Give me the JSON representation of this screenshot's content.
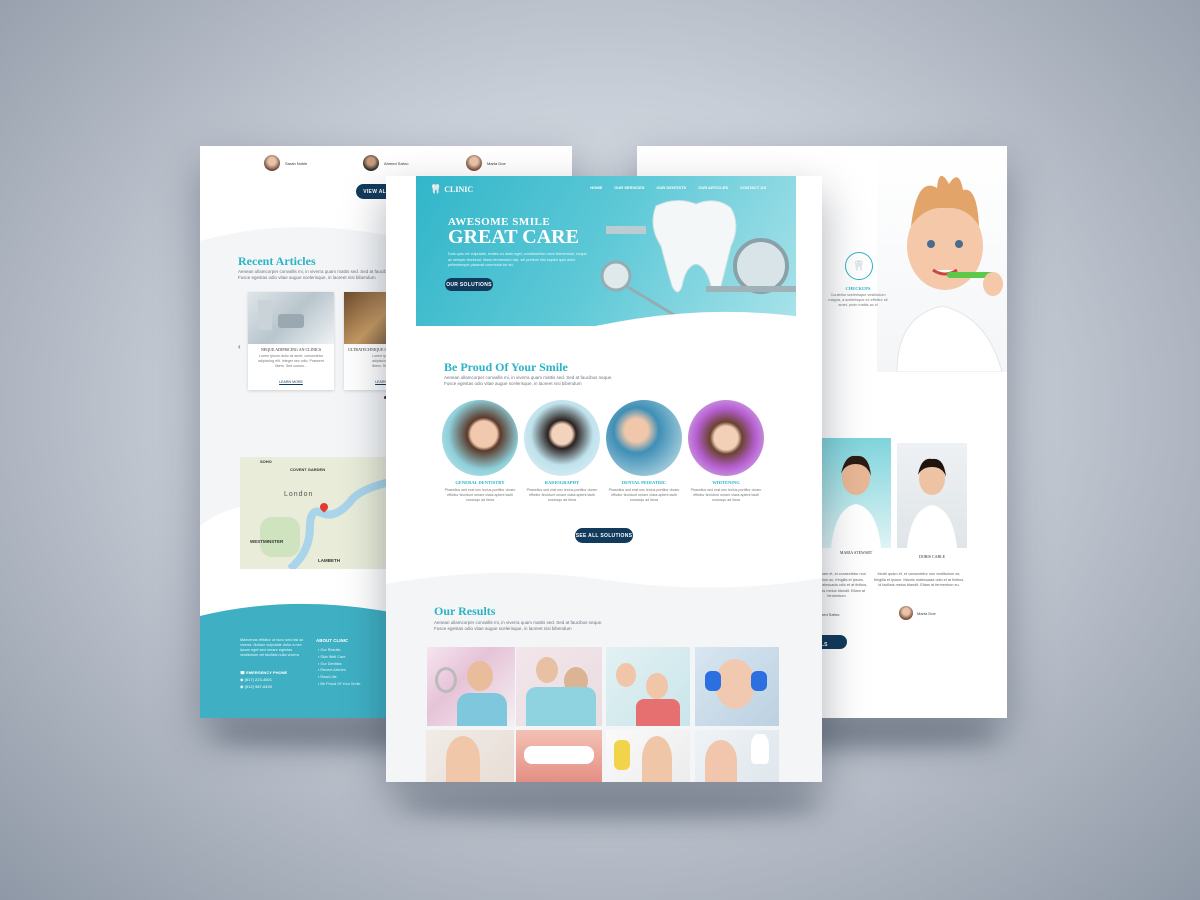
{
  "left": {
    "testimonials": [
      {
        "name": "Sarah Noble"
      },
      {
        "name": "Ahmed Sahro"
      },
      {
        "name": "Marta Doe"
      }
    ],
    "view_all_btn": "VIEW ALL TESTIMONIALS",
    "articles_title": "Recent Articles",
    "articles_text1": "Aenean ullamcorper convallis mi, in viverra quam mattis sed. Sed at faucibus neque.",
    "articles_text2": "Fusce egestas odio vitae augue scelerisque, in laoreet nisi bibendum",
    "article1_title": "NEQUE ADIPISCING AN CLINICS",
    "article1_text": "Lorem ipsum dolor sit amet, consectetur adipiscing elit. Integer nec odio. Praesent libero. Sed cursus...",
    "article1_link": "LEARN MORE",
    "article2_title": "ULTRATECHNIQUE IN DENTISTRY",
    "article2_text": "Lorem ipsum dolor sit amet, cor adipiscing elit. Integer n Praesent libero. Sed cursus...",
    "article2_link": "LEARN MORE",
    "map_labels": {
      "soho": "SOHO",
      "covent": "COVENT GARDEN",
      "london": "London",
      "westminster": "WESTMINSTER",
      "lambeth": "LAMBETH"
    },
    "footer_text": "Maecenas efficitur ut nunc sed nisi ac viverra. Nullam vulputate dolor a nec ipsum eget sed ornare egestas vestibulum vel facilisis nulla viverra",
    "emergency_label": "EMERGENCY PHONE",
    "phone1": "(617) 223-4501",
    "phone2": "(512) 987-6490",
    "about_title": "ABOUT CLINIC",
    "about_links": [
      "Our Results",
      "Skin Well Care",
      "Our Dentists",
      "Recent Articles",
      "Read Life",
      "Be Proud Of Your Smile"
    ]
  },
  "center": {
    "logo": "CLINIC",
    "nav": [
      "HOME",
      "OUR SERVICES",
      "OUR DENTISTS",
      "OUR ARTICLES",
      "CONTACT US"
    ],
    "hero_kicker": "AWESOME SMILE",
    "hero_title": "GREAT CARE",
    "hero_text": "Duis quis vel vulputate, erates eu diam eget, condimentum sem fermentum, neque ac semper tincidunt, libero fermentum nisl, vel pretium nisi sapien quis dolor pellentesque placerat commodo tur an.",
    "hero_btn": "OUR SOLUTIONS",
    "proud_title": "Be Proud Of Your Smile",
    "proud_text1": "Aenean ullamcorper convallis mi, in viverra quam mattis sed. Sed at faucibus neque.",
    "proud_text2": "Fusce egestas odio vitae augue scelerisque, in laoreet nisi bibendum",
    "services": [
      {
        "title": "GENERAL DENTISTRY",
        "text": "Phasellus sed erat nec lectus porttitor donec efficitur tincidunt ornare class aptent taciti sociosqu ad litora"
      },
      {
        "title": "RADIOGRAPHY",
        "text": "Phasellus sed erat nec lectus porttitor donec efficitur tincidunt ornare class aptent taciti sociosqu ad litora"
      },
      {
        "title": "DENTAL PEDIATRIC",
        "text": "Phasellus sed erat nec lectus porttitor donec efficitur tincidunt ornare class aptent taciti sociosqu ad litora"
      },
      {
        "title": "WHITENING",
        "text": "Phasellus sed erat nec lectus porttitor donec efficitur tincidunt ornare class aptent taciti sociosqu ad litora"
      }
    ],
    "see_all_btn": "SEE ALL SOLUTIONS",
    "results_title": "Our Results",
    "results_text1": "Aenean ullamcorper convallis mi, in viverra quam mattis sed. Sed at faucibus neque.",
    "results_text2": "Fusce egestas odio vitae augue scelerisque, in laoreet nisi bibendum"
  },
  "right": {
    "checkups_title": "CHECKUPS",
    "checkups_text": "Curabitur scelerisque vestibulum magna, a scelerisque ex efficitur sit amet, proin mattis ac id",
    "dentists": [
      {
        "name": "MARIA STEWART"
      },
      {
        "name": "DORIS CABLE"
      }
    ],
    "testimonial1": "Morbi quam et, et consectetur non vestibulum ac, fringilla et ipsum. Mauris malesuada odio et at finibus, id facilisis metus blandit. Etiam at fermentum.",
    "testimonial2": "Morbi quam et, et consectetur non vestibulum ac, fringilla et ipsum. Mauris malesuada odio et at finibus, id facilisis metus blandit. Etiam at fermentum eu.",
    "person1": "Ahmed Sahro",
    "person2": "Marta Doe",
    "btn": "VIEW ALL TESTIMONIALS"
  }
}
